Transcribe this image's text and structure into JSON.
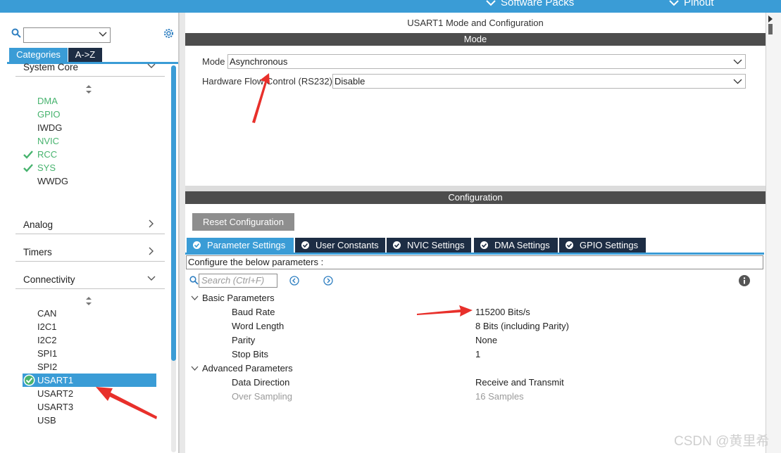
{
  "topbar": {
    "software_packs": "Software Packs",
    "pinout": "Pinout",
    "accent": "#3a9cd6"
  },
  "left": {
    "search_value": "",
    "tabs": {
      "categories": "Categories",
      "az": "A->Z"
    },
    "system_core": {
      "label": "System Core",
      "items": [
        {
          "label": "DMA",
          "state": "green"
        },
        {
          "label": "GPIO",
          "state": "green"
        },
        {
          "label": "IWDG",
          "state": "normal"
        },
        {
          "label": "NVIC",
          "state": "green"
        },
        {
          "label": "RCC",
          "state": "checked"
        },
        {
          "label": "SYS",
          "state": "checked"
        },
        {
          "label": "WWDG",
          "state": "normal"
        }
      ]
    },
    "analog": "Analog",
    "timers": "Timers",
    "connectivity": {
      "label": "Connectivity",
      "items": [
        "CAN",
        "I2C1",
        "I2C2",
        "SPI1",
        "SPI2",
        "USART1",
        "USART2",
        "USART3",
        "USB"
      ],
      "selected": "USART1"
    }
  },
  "mode_panel": {
    "title": "USART1 Mode and Configuration",
    "bar": "Mode",
    "mode_label": "Mode",
    "mode_value": "Asynchronous",
    "hw_flow_label": "Hardware Flow Control (RS232)",
    "hw_flow_value": "Disable"
  },
  "config_panel": {
    "bar": "Configuration",
    "reset_button": "Reset Configuration",
    "tabs": [
      "Parameter Settings",
      "User Constants",
      "NVIC Settings",
      "DMA Settings",
      "GPIO Settings"
    ],
    "description": "Configure the below parameters :",
    "search_placeholder": "Search (Ctrl+F)",
    "basic": {
      "label": "Basic Parameters",
      "rows": [
        {
          "name": "Baud Rate",
          "value": "115200 Bits/s"
        },
        {
          "name": "Word Length",
          "value": "8 Bits (including Parity)"
        },
        {
          "name": "Parity",
          "value": "None"
        },
        {
          "name": "Stop Bits",
          "value": "1"
        }
      ]
    },
    "advanced": {
      "label": "Advanced Parameters",
      "rows": [
        {
          "name": "Data Direction",
          "value": "Receive and Transmit"
        },
        {
          "name": "Over Sampling",
          "value": "16 Samples"
        }
      ]
    }
  },
  "watermark": "CSDN @黄里希",
  "colors": {
    "accent": "#3a9cd6",
    "dark_tab": "#1d2d44",
    "green": "#47b36e",
    "arrow": "#e8302b"
  }
}
